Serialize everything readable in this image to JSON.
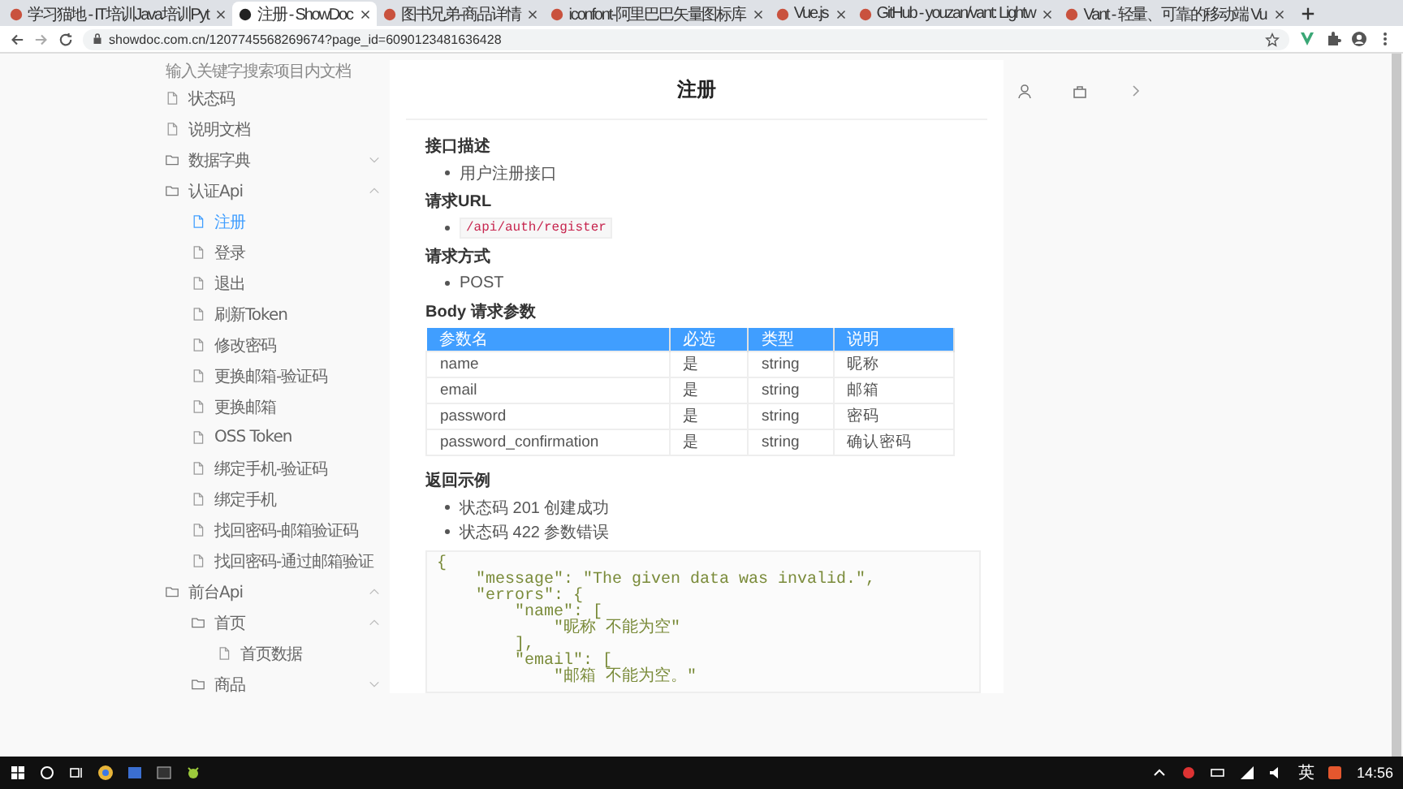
{
  "tabs": [
    {
      "title": "学习猫地 - IT培训Java培训Pyt",
      "selected": false
    },
    {
      "title": "注册 - ShowDoc",
      "selected": true
    },
    {
      "title": "图书兄弟-商品详情",
      "selected": false
    },
    {
      "title": "iconfont-阿里巴巴矢量图标库",
      "selected": false
    },
    {
      "title": "Vue.js",
      "selected": false
    },
    {
      "title": "GitHub - youzan/vant: Lightw",
      "selected": false
    },
    {
      "title": "Vant - 轻量、可靠的移动端 Vu",
      "selected": false
    }
  ],
  "address_bar": {
    "url": "showdoc.com.cn/1207745568269674?page_id=6090123481636428"
  },
  "sidebar": {
    "search": {
      "placeholder": "输入关键字搜索项目内文档"
    },
    "items": [
      {
        "label": "状态码",
        "kind": "file",
        "selected": false
      },
      {
        "label": "说明文档",
        "kind": "file",
        "selected": false
      },
      {
        "label": "数据字典",
        "kind": "folder",
        "expanded": false
      },
      {
        "label": "认证Api",
        "kind": "folder",
        "expanded": true,
        "children": [
          {
            "label": "注册",
            "kind": "file",
            "selected": true
          },
          {
            "label": "登录",
            "kind": "file",
            "selected": false
          },
          {
            "label": "退出",
            "kind": "file",
            "selected": false
          },
          {
            "label": "刷新Token",
            "kind": "file",
            "selected": false
          },
          {
            "label": "修改密码",
            "kind": "file",
            "selected": false
          },
          {
            "label": "更换邮箱-验证码",
            "kind": "file",
            "selected": false
          },
          {
            "label": "更换邮箱",
            "kind": "file",
            "selected": false
          },
          {
            "label": "OSS Token",
            "kind": "file",
            "selected": false
          },
          {
            "label": "绑定手机-验证码",
            "kind": "file",
            "selected": false
          },
          {
            "label": "绑定手机",
            "kind": "file",
            "selected": false
          },
          {
            "label": "找回密码-邮箱验证码",
            "kind": "file",
            "selected": false
          },
          {
            "label": "找回密码-通过邮箱验证",
            "kind": "file",
            "selected": false
          }
        ]
      },
      {
        "label": "前台Api",
        "kind": "folder",
        "expanded": true,
        "children": [
          {
            "label": "首页",
            "kind": "folder",
            "expanded": true,
            "children": [
              {
                "label": "首页数据",
                "kind": "file",
                "selected": false
              }
            ]
          },
          {
            "label": "商品",
            "kind": "folder",
            "expanded": false
          }
        ]
      }
    ]
  },
  "doc": {
    "title": "注册",
    "sections": [
      {
        "heading": "接口描述",
        "items": [
          {
            "kind": "text",
            "text": "用户注册接口"
          }
        ]
      },
      {
        "heading": "请求URL",
        "items": [
          {
            "kind": "code",
            "text": "/api/auth/register"
          }
        ]
      },
      {
        "heading": "请求方式",
        "items": [
          {
            "kind": "text",
            "text": "POST"
          }
        ]
      },
      {
        "heading": "Body 请求参数",
        "table": {
          "columns": [
            "参数名",
            "必选",
            "类型",
            "说明"
          ],
          "rows": [
            [
              "name",
              "是",
              "string",
              "昵称"
            ],
            [
              "email",
              "是",
              "string",
              "邮箱"
            ],
            [
              "password",
              "是",
              "string",
              "密码"
            ],
            [
              "password_confirmation",
              "是",
              "string",
              "确认密码"
            ]
          ]
        }
      },
      {
        "heading": "返回示例",
        "items": [
          {
            "kind": "text",
            "text": "状态码 201 创建成功"
          },
          {
            "kind": "text",
            "text": "状态码 422 参数错误"
          }
        ],
        "code": [
          "{",
          "    \"message\": \"The given data was invalid.\",",
          "    \"errors\": {",
          "        \"name\": [",
          "            \"昵称 不能为空\"",
          "        ],",
          "        \"email\": [",
          "            \"邮箱 不能为空。\""
        ]
      }
    ]
  },
  "taskbar": {
    "input_method": "英",
    "time": "14:56"
  }
}
